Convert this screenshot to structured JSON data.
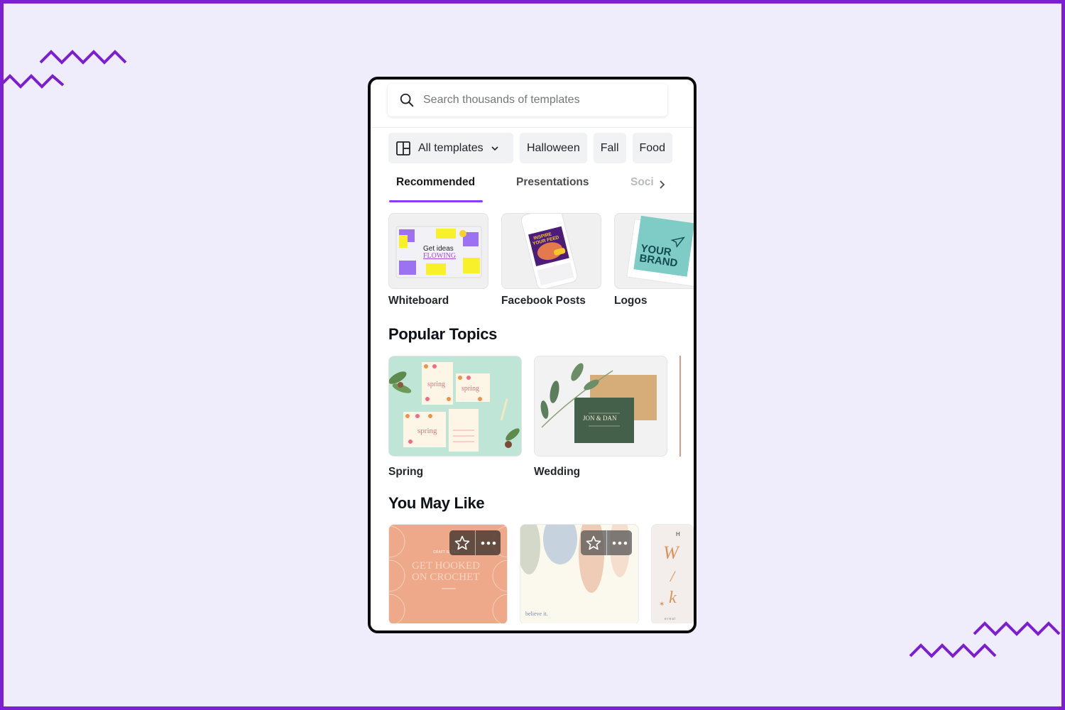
{
  "colors": {
    "background": "#efedfb",
    "frame_accent": "#7b1fd0",
    "tab_underline": "#8b3dff"
  },
  "search": {
    "placeholder": "Search thousands of templates",
    "value": "",
    "icon": "search-icon"
  },
  "chips": [
    {
      "label": "All templates",
      "icon": "layout-icon",
      "dropdown": true
    },
    {
      "label": "Halloween"
    },
    {
      "label": "Fall"
    },
    {
      "label": "Food"
    }
  ],
  "tabs": {
    "items": [
      {
        "label": "Recommended",
        "active": true
      },
      {
        "label": "Presentations",
        "active": false
      },
      {
        "label": "Soci",
        "active": false
      }
    ],
    "next_icon": "chevron-right-icon"
  },
  "recommended": [
    {
      "label": "Whiteboard",
      "thumb_text": [
        "Get ideas",
        "FLOWING"
      ]
    },
    {
      "label": "Facebook Posts",
      "thumb_text": [
        "INSPIRE",
        "YOUR FEED"
      ]
    },
    {
      "label": "Logos",
      "thumb_text": [
        "YOUR",
        "BRAND"
      ]
    }
  ],
  "popular_topics": {
    "title": "Popular Topics",
    "items": [
      {
        "label": "Spring",
        "thumb_text": "spring"
      },
      {
        "label": "Wedding",
        "thumb_text": "JON & DAN"
      }
    ]
  },
  "you_may_like": {
    "title": "You May Like",
    "items": [
      {
        "thumb_text": [
          "CRAFT SERIES",
          "GET HOOKED",
          "ON CROCHET"
        ],
        "actions": [
          "star-icon",
          "more-icon"
        ]
      },
      {
        "thumb_text": [
          "believe it."
        ],
        "actions": [
          "star-icon",
          "more-icon"
        ]
      },
      {
        "thumb_text": [
          "H",
          "W",
          "ereal"
        ]
      }
    ]
  }
}
